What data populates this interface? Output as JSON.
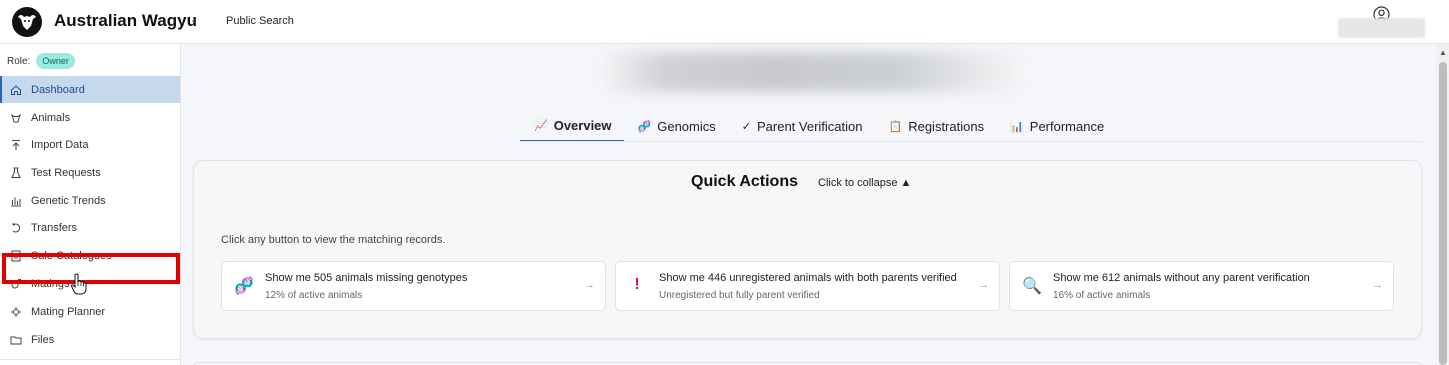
{
  "header": {
    "brand": "Australian Wagyu",
    "brand_chevron": "⌄",
    "public_search": "Public Search"
  },
  "sidebar": {
    "role_label": "Role:",
    "role_badge": "Owner",
    "items": [
      {
        "label": "Dashboard",
        "icon": "home-icon",
        "active": true
      },
      {
        "label": "Animals",
        "icon": "animal-icon"
      },
      {
        "label": "Import Data",
        "icon": "upload-icon"
      },
      {
        "label": "Test Requests",
        "icon": "flask-icon"
      },
      {
        "label": "Genetic Trends",
        "icon": "bar-chart-icon"
      },
      {
        "label": "Transfers",
        "icon": "transfer-icon"
      },
      {
        "label": "Sale Catalogues",
        "icon": "catalogue-icon"
      },
      {
        "label": "Matings",
        "icon": "mating-icon"
      },
      {
        "label": "Mating Planner",
        "icon": "planner-icon",
        "highlighted": true
      },
      {
        "label": "Files",
        "icon": "folder-icon"
      }
    ]
  },
  "tabs": [
    {
      "label": "Overview",
      "icon": "📈",
      "active": true
    },
    {
      "label": "Genomics",
      "icon": "🧬"
    },
    {
      "label": "Parent Verification",
      "icon": "✓"
    },
    {
      "label": "Registrations",
      "icon": "📋"
    },
    {
      "label": "Performance",
      "icon": "📊"
    }
  ],
  "quick_actions": {
    "title": "Quick Actions",
    "collapse_label": "Click to collapse ▲",
    "hint": "Click any button to view the matching records.",
    "actions": [
      {
        "icon": "🧬",
        "title": "Show me 505 animals missing genotypes",
        "subtitle": "12% of active animals",
        "arrow": "→"
      },
      {
        "icon": "!",
        "title": "Show me 446 unregistered animals with both parents verified",
        "subtitle": "Unregistered but fully parent verified",
        "arrow": "→"
      },
      {
        "icon": "🔍",
        "title": "Show me 612 animals without any parent verification",
        "subtitle": "16% of active animals",
        "arrow": "→"
      }
    ]
  },
  "colors": {
    "accent": "#2a66b0",
    "active_nav_bg": "#c5d8ee",
    "role_badge_bg": "#9be9e0",
    "highlight": "#e00000"
  }
}
